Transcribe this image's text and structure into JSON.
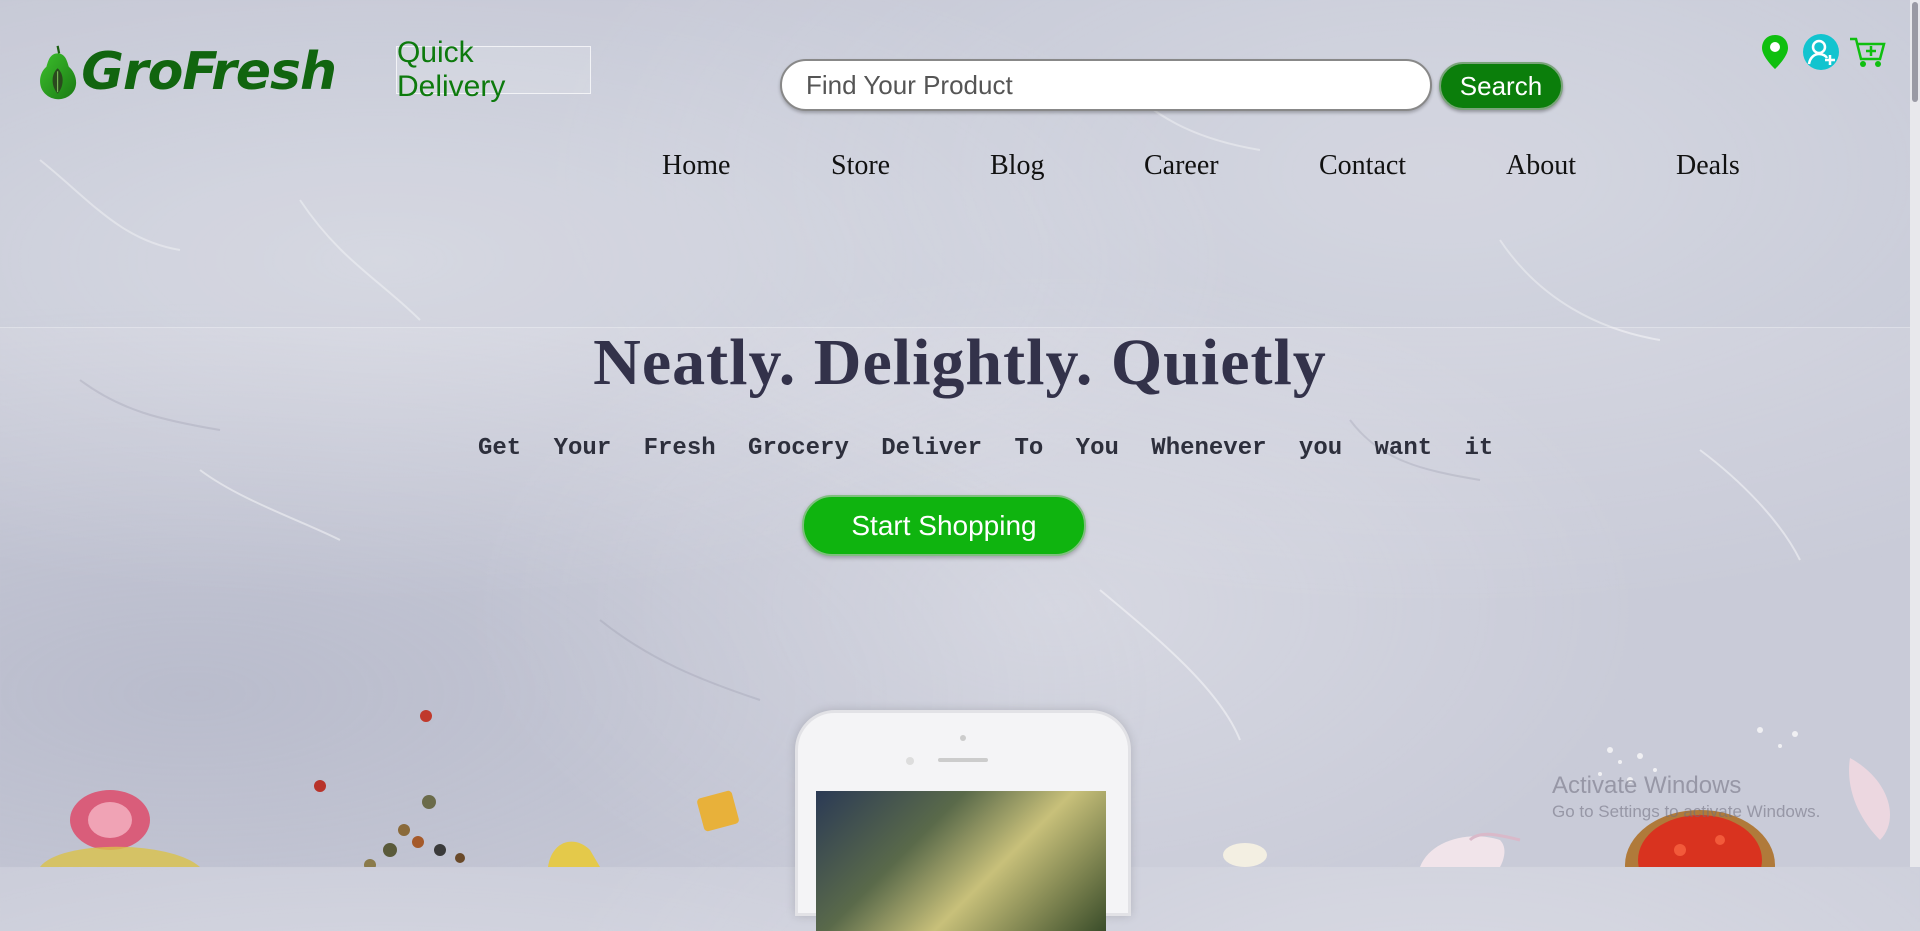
{
  "brand": {
    "name": "GroFresh",
    "tagline_badge": "Quick Delivery",
    "color": "#11650f"
  },
  "search": {
    "placeholder": "Find Your Product",
    "button_label": "Search"
  },
  "header_icons": [
    {
      "name": "location-pin-icon",
      "color": "#0fbf0f"
    },
    {
      "name": "add-user-icon",
      "color": "#0fbfd0"
    },
    {
      "name": "cart-add-icon",
      "color": "#0fbf0f"
    }
  ],
  "nav": {
    "items": [
      {
        "label": "Home"
      },
      {
        "label": "Store"
      },
      {
        "label": "Blog"
      },
      {
        "label": "Career"
      },
      {
        "label": "Contact"
      },
      {
        "label": "About"
      },
      {
        "label": "Deals"
      }
    ]
  },
  "hero": {
    "title": "Neatly. Delightly. Quietly",
    "subtitle": "Get Your Fresh Grocery Deliver To You Whenever you want it",
    "cta_label": "Start Shopping",
    "cta_color": "#0fb40f"
  },
  "watermark": {
    "line1": "Activate Windows",
    "line2": "Go to Settings to activate Windows."
  }
}
